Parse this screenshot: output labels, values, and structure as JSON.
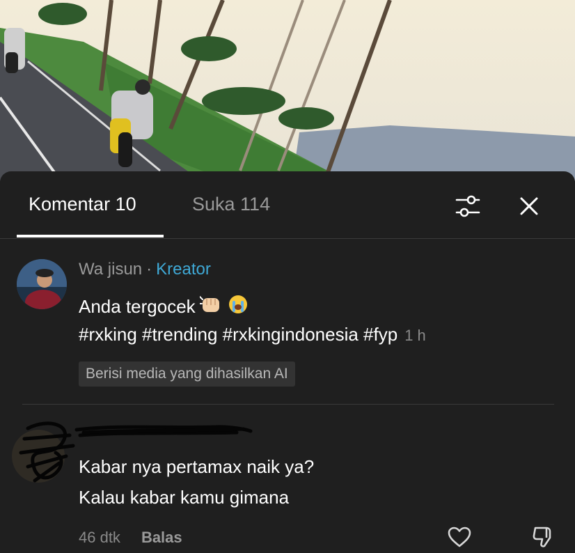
{
  "tabs": {
    "comments_label": "Komentar 10",
    "likes_label": "Suka 114"
  },
  "icons": {
    "filter": "sliders-filter-icon",
    "close": "close-x-icon",
    "like": "heart-outline-icon",
    "dislike": "thumbs-down-outline-icon",
    "emoji_fist": "oncoming-fist-emoji",
    "emoji_cry": "loudly-crying-face-emoji"
  },
  "comments": [
    {
      "username": "Wa jisun",
      "separator": "·",
      "role": "Kreator",
      "text": "Anda tergocek",
      "hashtags": "#rxking #trending #rxkingindonesia #fyp",
      "time": "1 h",
      "badge": "Berisi media yang dihasilkan AI"
    },
    {
      "line1": "Kabar nya pertamax naik ya?",
      "line2": "Kalau kabar kamu gimana",
      "time": "46 dtk",
      "reply": "Balas"
    }
  ],
  "colors": {
    "sheet_bg": "#1f1f1f",
    "primary_text": "#ffffff",
    "secondary_text": "#9a9a9a",
    "creator_accent": "#3fa9d6"
  }
}
